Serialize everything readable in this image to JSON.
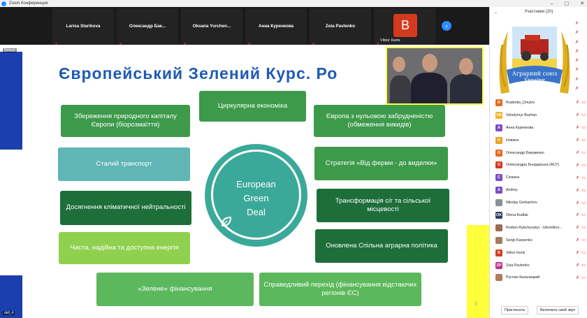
{
  "window": {
    "title": "Zoom Конференция"
  },
  "gallery": {
    "tiles": [
      "Larisa Starikova",
      "Олександр Бак...",
      "Oksana Yurchen...",
      "Анна Куренкова",
      "Zoia Pavlenko"
    ],
    "avatar_letter": "B",
    "avatar_name": "Viktor Hurts",
    "next_arrow": "›"
  },
  "share": {
    "presenter_label": "Semyo",
    "device_label": "dell_4"
  },
  "slide": {
    "title": "Європейський Зелений Курс. Ро",
    "boxes": [
      "Збереження природного капіталу Європи (біорозмаїття)",
      "Циркулярна  економіка",
      "Європа з нульовою забрудненістю (обмеження викидів)",
      "Сталий транспорт",
      "Стратегія «Від ферми  - до виделки»",
      "Досягнення кліматичної нейтральності",
      "Трансформація с/г та сільської місцевості",
      "Чиста, надійна та доступна енергія",
      "Оновлена Спільна аграрна політика",
      "«Зелене» фінансування",
      "Справедливий перехід (фінансування відстаючих регіонів ЄС)"
    ],
    "center_lines": [
      "European",
      "Green",
      "Deal"
    ],
    "page_number": "3"
  },
  "panel": {
    "header": "Участники (20)",
    "logo_text_line1": "Аграрний союз",
    "logo_text_line2": "України",
    "participants": [
      {
        "initials": "R",
        "name": "Rudenko_Dmytro",
        "color": "#e8681f"
      },
      {
        "initials": "VB",
        "name": "Volodymyr Buzhan",
        "color": "#f0b429"
      },
      {
        "initials": "А",
        "name": "Анна Куренкова",
        "color": "#7d4cc4"
      },
      {
        "initials": "Н",
        "name": "Новікоє",
        "color": "#e8a21f"
      },
      {
        "initials": "О",
        "name": "Олександр Бакуменко",
        "color": "#e8681f"
      },
      {
        "initials": "О",
        "name": "Олександра Бондарська (АСУ)",
        "color": "#d43a1f"
      },
      {
        "initials": "С",
        "name": "Сюзана",
        "color": "#7d4cc4"
      },
      {
        "initials": "A",
        "name": "Andrey",
        "color": "#7d4cc4"
      },
      {
        "initials": "",
        "name": "Nikolay Gorbachov",
        "color": "#8a8f99"
      },
      {
        "initials": "OK",
        "name": "Olena Kudlak",
        "color": "#2c3e66"
      },
      {
        "initials": "",
        "name": "Rodion Rybchynskyi - Ukrmillers...",
        "color": "#9a6b4f"
      },
      {
        "initials": "",
        "name": "Sergii Karpenko",
        "color": "#a57b62"
      },
      {
        "initials": "B",
        "name": "Viktor Hurts",
        "color": "#d43a1f"
      },
      {
        "initials": "ZP",
        "name": "Zoia Pavlenko",
        "color": "#c2338f"
      },
      {
        "initials": "",
        "name": "Руслан Кальницкий",
        "color": "#b07a5d"
      }
    ],
    "invite_label": "Пригласить",
    "mute_label": "Включить свой звук"
  },
  "colors": {
    "zoom_blue": "#2d8cff",
    "slide_title": "#1f5bb5",
    "mic_red": "#e02828"
  }
}
